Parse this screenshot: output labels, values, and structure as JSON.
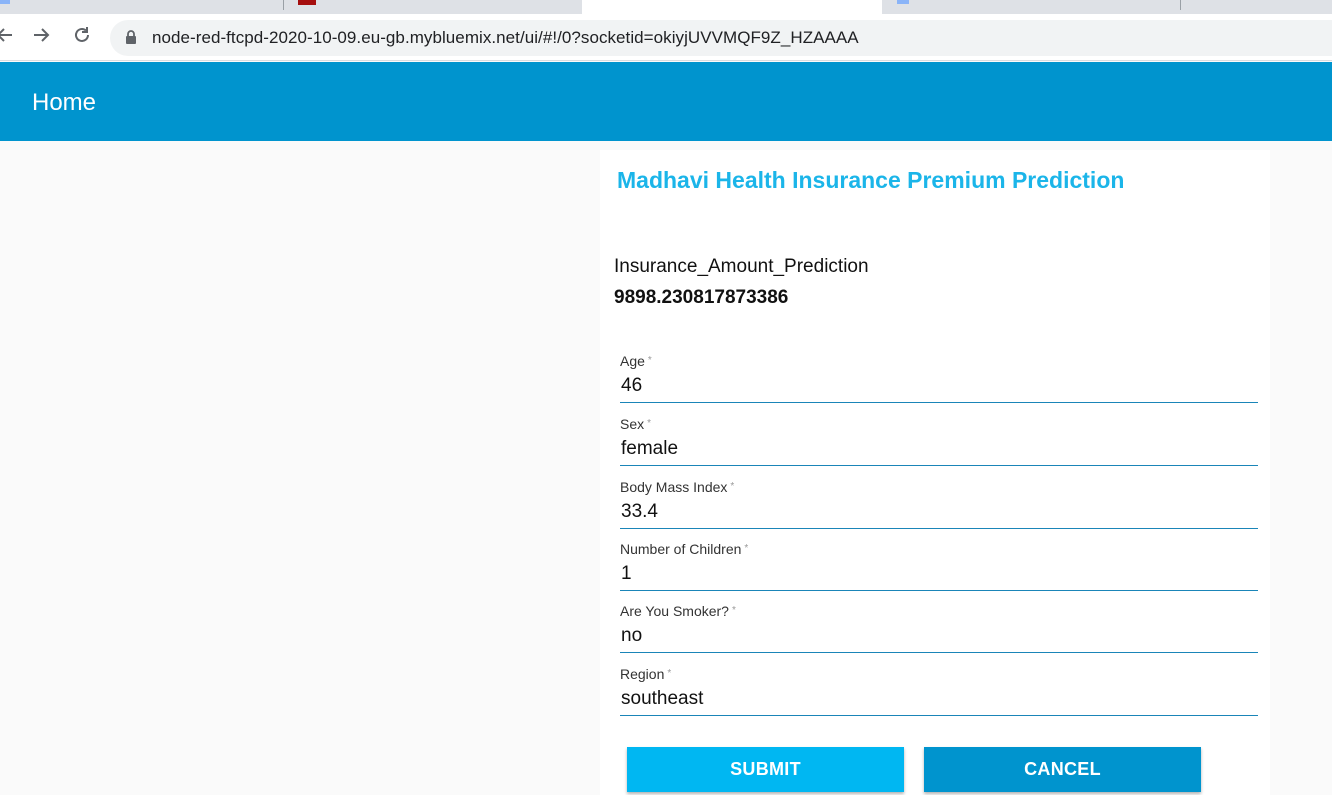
{
  "browser": {
    "url": "node-red-ftcpd-2020-10-09.eu-gb.mybluemix.net/ui/#!/0?socketid=okiyjUVVMQF9Z_HZAAAA"
  },
  "header": {
    "title": "Home"
  },
  "card": {
    "title": "Madhavi Health Insurance Premium Prediction",
    "prediction_label": "Insurance_Amount_Prediction",
    "prediction_value": "9898.230817873386"
  },
  "form": {
    "required_mark": "*",
    "fields": [
      {
        "label": "Age",
        "value": "46"
      },
      {
        "label": "Sex",
        "value": "female"
      },
      {
        "label": "Body Mass Index",
        "value": "33.4"
      },
      {
        "label": "Number of Children",
        "value": "1"
      },
      {
        "label": "Are You Smoker?",
        "value": "no"
      },
      {
        "label": "Region",
        "value": "southeast"
      }
    ],
    "submit_label": "SUBMIT",
    "cancel_label": "CANCEL"
  },
  "colors": {
    "header_bg": "#0094ce",
    "title_color": "#1bb5e9",
    "submit_bg": "#00b7f2",
    "cancel_bg": "#0094ce"
  }
}
